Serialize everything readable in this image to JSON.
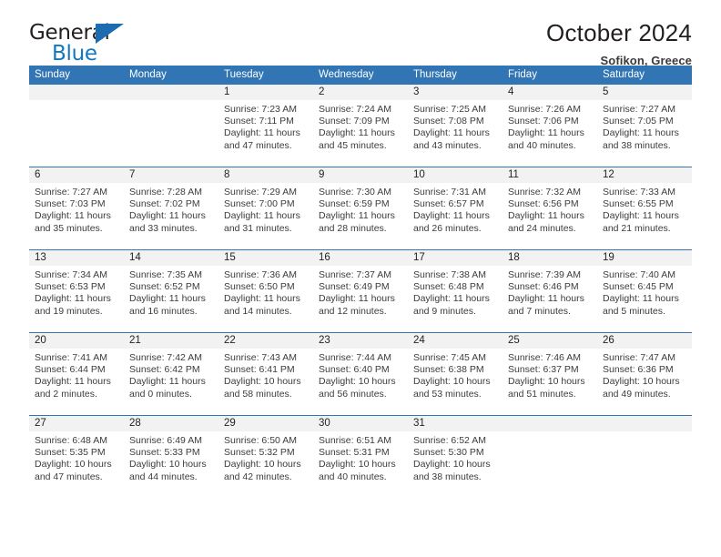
{
  "logo": {
    "word_one": "General",
    "word_two": "Blue",
    "triangle_color": "#1b6cb0",
    "blue_text_color": "#1278be"
  },
  "header": {
    "title": "October 2024",
    "subtitle": "Sofikon, Greece"
  },
  "theme": {
    "header_blue": "#3275b4",
    "date_band_gray": "#f2f2f2",
    "text_color": "#231f20"
  },
  "calendar": {
    "weekday_headers": [
      "Sunday",
      "Monday",
      "Tuesday",
      "Wednesday",
      "Thursday",
      "Friday",
      "Saturday"
    ],
    "weeks": [
      [
        {
          "day": "",
          "empty": true
        },
        {
          "day": "",
          "empty": true
        },
        {
          "day": "1",
          "sunrise": "Sunrise: 7:23 AM",
          "sunset": "Sunset: 7:11 PM",
          "daylight_line1": "Daylight: 11 hours",
          "daylight_line2": "and 47 minutes."
        },
        {
          "day": "2",
          "sunrise": "Sunrise: 7:24 AM",
          "sunset": "Sunset: 7:09 PM",
          "daylight_line1": "Daylight: 11 hours",
          "daylight_line2": "and 45 minutes."
        },
        {
          "day": "3",
          "sunrise": "Sunrise: 7:25 AM",
          "sunset": "Sunset: 7:08 PM",
          "daylight_line1": "Daylight: 11 hours",
          "daylight_line2": "and 43 minutes."
        },
        {
          "day": "4",
          "sunrise": "Sunrise: 7:26 AM",
          "sunset": "Sunset: 7:06 PM",
          "daylight_line1": "Daylight: 11 hours",
          "daylight_line2": "and 40 minutes."
        },
        {
          "day": "5",
          "sunrise": "Sunrise: 7:27 AM",
          "sunset": "Sunset: 7:05 PM",
          "daylight_line1": "Daylight: 11 hours",
          "daylight_line2": "and 38 minutes."
        }
      ],
      [
        {
          "day": "6",
          "sunrise": "Sunrise: 7:27 AM",
          "sunset": "Sunset: 7:03 PM",
          "daylight_line1": "Daylight: 11 hours",
          "daylight_line2": "and 35 minutes."
        },
        {
          "day": "7",
          "sunrise": "Sunrise: 7:28 AM",
          "sunset": "Sunset: 7:02 PM",
          "daylight_line1": "Daylight: 11 hours",
          "daylight_line2": "and 33 minutes."
        },
        {
          "day": "8",
          "sunrise": "Sunrise: 7:29 AM",
          "sunset": "Sunset: 7:00 PM",
          "daylight_line1": "Daylight: 11 hours",
          "daylight_line2": "and 31 minutes."
        },
        {
          "day": "9",
          "sunrise": "Sunrise: 7:30 AM",
          "sunset": "Sunset: 6:59 PM",
          "daylight_line1": "Daylight: 11 hours",
          "daylight_line2": "and 28 minutes."
        },
        {
          "day": "10",
          "sunrise": "Sunrise: 7:31 AM",
          "sunset": "Sunset: 6:57 PM",
          "daylight_line1": "Daylight: 11 hours",
          "daylight_line2": "and 26 minutes."
        },
        {
          "day": "11",
          "sunrise": "Sunrise: 7:32 AM",
          "sunset": "Sunset: 6:56 PM",
          "daylight_line1": "Daylight: 11 hours",
          "daylight_line2": "and 24 minutes."
        },
        {
          "day": "12",
          "sunrise": "Sunrise: 7:33 AM",
          "sunset": "Sunset: 6:55 PM",
          "daylight_line1": "Daylight: 11 hours",
          "daylight_line2": "and 21 minutes."
        }
      ],
      [
        {
          "day": "13",
          "sunrise": "Sunrise: 7:34 AM",
          "sunset": "Sunset: 6:53 PM",
          "daylight_line1": "Daylight: 11 hours",
          "daylight_line2": "and 19 minutes."
        },
        {
          "day": "14",
          "sunrise": "Sunrise: 7:35 AM",
          "sunset": "Sunset: 6:52 PM",
          "daylight_line1": "Daylight: 11 hours",
          "daylight_line2": "and 16 minutes."
        },
        {
          "day": "15",
          "sunrise": "Sunrise: 7:36 AM",
          "sunset": "Sunset: 6:50 PM",
          "daylight_line1": "Daylight: 11 hours",
          "daylight_line2": "and 14 minutes."
        },
        {
          "day": "16",
          "sunrise": "Sunrise: 7:37 AM",
          "sunset": "Sunset: 6:49 PM",
          "daylight_line1": "Daylight: 11 hours",
          "daylight_line2": "and 12 minutes."
        },
        {
          "day": "17",
          "sunrise": "Sunrise: 7:38 AM",
          "sunset": "Sunset: 6:48 PM",
          "daylight_line1": "Daylight: 11 hours",
          "daylight_line2": "and 9 minutes."
        },
        {
          "day": "18",
          "sunrise": "Sunrise: 7:39 AM",
          "sunset": "Sunset: 6:46 PM",
          "daylight_line1": "Daylight: 11 hours",
          "daylight_line2": "and 7 minutes."
        },
        {
          "day": "19",
          "sunrise": "Sunrise: 7:40 AM",
          "sunset": "Sunset: 6:45 PM",
          "daylight_line1": "Daylight: 11 hours",
          "daylight_line2": "and 5 minutes."
        }
      ],
      [
        {
          "day": "20",
          "sunrise": "Sunrise: 7:41 AM",
          "sunset": "Sunset: 6:44 PM",
          "daylight_line1": "Daylight: 11 hours",
          "daylight_line2": "and 2 minutes."
        },
        {
          "day": "21",
          "sunrise": "Sunrise: 7:42 AM",
          "sunset": "Sunset: 6:42 PM",
          "daylight_line1": "Daylight: 11 hours",
          "daylight_line2": "and 0 minutes."
        },
        {
          "day": "22",
          "sunrise": "Sunrise: 7:43 AM",
          "sunset": "Sunset: 6:41 PM",
          "daylight_line1": "Daylight: 10 hours",
          "daylight_line2": "and 58 minutes."
        },
        {
          "day": "23",
          "sunrise": "Sunrise: 7:44 AM",
          "sunset": "Sunset: 6:40 PM",
          "daylight_line1": "Daylight: 10 hours",
          "daylight_line2": "and 56 minutes."
        },
        {
          "day": "24",
          "sunrise": "Sunrise: 7:45 AM",
          "sunset": "Sunset: 6:38 PM",
          "daylight_line1": "Daylight: 10 hours",
          "daylight_line2": "and 53 minutes."
        },
        {
          "day": "25",
          "sunrise": "Sunrise: 7:46 AM",
          "sunset": "Sunset: 6:37 PM",
          "daylight_line1": "Daylight: 10 hours",
          "daylight_line2": "and 51 minutes."
        },
        {
          "day": "26",
          "sunrise": "Sunrise: 7:47 AM",
          "sunset": "Sunset: 6:36 PM",
          "daylight_line1": "Daylight: 10 hours",
          "daylight_line2": "and 49 minutes."
        }
      ],
      [
        {
          "day": "27",
          "sunrise": "Sunrise: 6:48 AM",
          "sunset": "Sunset: 5:35 PM",
          "daylight_line1": "Daylight: 10 hours",
          "daylight_line2": "and 47 minutes."
        },
        {
          "day": "28",
          "sunrise": "Sunrise: 6:49 AM",
          "sunset": "Sunset: 5:33 PM",
          "daylight_line1": "Daylight: 10 hours",
          "daylight_line2": "and 44 minutes."
        },
        {
          "day": "29",
          "sunrise": "Sunrise: 6:50 AM",
          "sunset": "Sunset: 5:32 PM",
          "daylight_line1": "Daylight: 10 hours",
          "daylight_line2": "and 42 minutes."
        },
        {
          "day": "30",
          "sunrise": "Sunrise: 6:51 AM",
          "sunset": "Sunset: 5:31 PM",
          "daylight_line1": "Daylight: 10 hours",
          "daylight_line2": "and 40 minutes."
        },
        {
          "day": "31",
          "sunrise": "Sunrise: 6:52 AM",
          "sunset": "Sunset: 5:30 PM",
          "daylight_line1": "Daylight: 10 hours",
          "daylight_line2": "and 38 minutes."
        },
        {
          "day": "",
          "empty": true
        },
        {
          "day": "",
          "empty": true
        }
      ]
    ]
  }
}
